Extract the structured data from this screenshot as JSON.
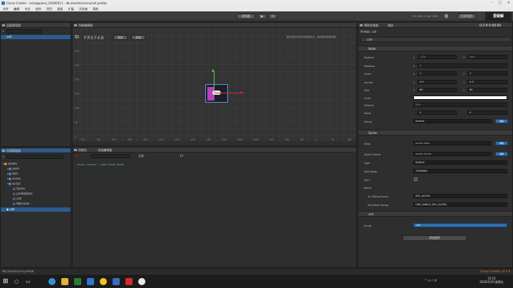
{
  "window": {
    "title": "Cocos Creator - orangepiece_20200511 - db://assets/scene/cell.prefab",
    "build_tag": "Cocos Creator v2.3.4"
  },
  "menu": [
    "文件",
    "编辑",
    "节点",
    "组件",
    "项目",
    "面板",
    "扩展",
    "开发者",
    "帮助"
  ],
  "toolbar": {
    "preview_target": "浏览器",
    "ip": "192.168.1.106:7456",
    "project_button": "打开项目"
  },
  "hierarchy": {
    "title": "层级管理器",
    "nodes": [
      "cell"
    ]
  },
  "scene": {
    "title": "场景编辑器",
    "save_label": "保存",
    "close_label": "关闭",
    "prefab_label": "PREFAB",
    "hint": "使用鼠标右键平移视窗焦点，使用滚轮缩放视图",
    "y_ticks": [
      "300",
      "250",
      "200",
      "150",
      "100",
      "50",
      "0"
    ],
    "x_ticks": [
      "-750",
      "-700",
      "-650",
      "-600",
      "-550",
      "-500",
      "-450",
      "-400",
      "-350",
      "-300",
      "-250",
      "-200",
      "-150",
      "-100",
      "-50",
      "0",
      "50",
      "100"
    ]
  },
  "assets": {
    "title": "资源管理器",
    "root": "assets",
    "folders": [
      "anim",
      "font",
      "scene",
      "script"
    ],
    "files": [
      "Game",
      "prefabData",
      "cell",
      "Welcome"
    ],
    "selected": "cell"
  },
  "console": {
    "tab1": "控制台",
    "tab2": "动画编辑器",
    "log": "Cocos Creator: Load Scene done!",
    "level": "全部",
    "size": "14"
  },
  "statusbar": {
    "path": "db://assets/cell.prefab"
  },
  "inspector": {
    "tab1": "属性检查器",
    "tab2": "服务",
    "prefab_name": "cell",
    "node_header": "Node",
    "props": [
      {
        "label": "Position",
        "x": "-220",
        "y": "160"
      },
      {
        "label": "Rotation",
        "x": "0"
      },
      {
        "label": "Scale",
        "x": "1",
        "y": "1"
      },
      {
        "label": "Anchor",
        "x": "0.5",
        "y": "0.5"
      },
      {
        "label": "Size",
        "x": "80",
        "y": "80"
      }
    ],
    "color_label": "Color",
    "opacity_label": "Opacity",
    "opacity": "255",
    "skew_label": "Skew",
    "skew_x": "0",
    "skew_y": "0",
    "group_label": "Group",
    "group": "default",
    "edit_label": "编辑",
    "sprite_header": "Sprite",
    "atlas_label": "Atlas",
    "atlas_value": "sprite-atlas",
    "frame_label": "Sprite Frame",
    "frame_value": "sprite-frame",
    "type_label": "Type",
    "type": "SIMPLE",
    "sizemode_label": "Size Mode",
    "sizemode": "TRIMMED",
    "trim_label": "Trim",
    "blend_label": "Blend",
    "src_label": "Src Blend Factor",
    "src": "SRC_ALPHA",
    "dst_label": "Dst Blend Factor",
    "dst": "ONE_MINUS_SRC_ALPHA",
    "cell_header": "cell",
    "script_label": "Script",
    "script_value": "cell",
    "add_component": "添加组件"
  },
  "overlay": {
    "watermark": "爱破解",
    "timer": "0:2:9 0:00:00"
  },
  "taskbar": {
    "time": "15:21",
    "date": "2020/5/29 星期五"
  },
  "colors": {
    "accent": "#2f6fb1",
    "position_value": "#e08a2b",
    "selected_row": "#2b5c8f"
  }
}
